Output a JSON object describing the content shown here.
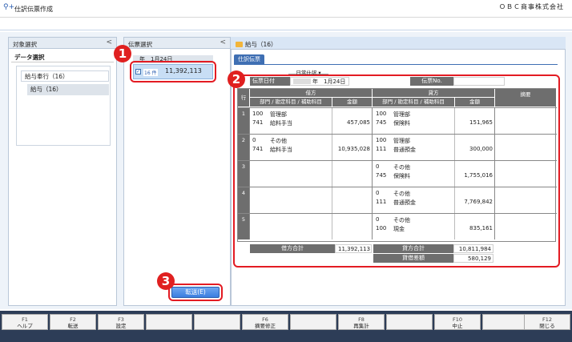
{
  "window": {
    "title": "仕訳伝票作成",
    "company": "ＯＢＣ商事株式会社"
  },
  "left": {
    "header": "対象選択",
    "data_label": "データ選択",
    "parent": "給与奉行（16）",
    "child": "給与（16）"
  },
  "middle": {
    "header": "伝票選択",
    "slip_header": "年　1月24日",
    "slip_count": "16 件",
    "slip_amount": "11,392,113",
    "transfer_button": "転送(E)"
  },
  "right": {
    "header": "給与（16）",
    "tab": "仕訳伝票",
    "type_select": "日常仕訳",
    "date_label": "伝票日付",
    "date_value": "年　1月24日",
    "no_label": "伝票No.",
    "col_row": "行",
    "col_debit": "借方",
    "col_credit": "貸方",
    "col_memo": "摘要",
    "col_dept": "部門 / 勘定科目 / 補助科目",
    "col_amount": "金額",
    "rows": [
      {
        "n": "1",
        "d_code1": "100",
        "d_name1": "管理部",
        "d_code2": "741",
        "d_name2": "給料手当",
        "d_amt": "457,085",
        "c_code1": "100",
        "c_name1": "管理部",
        "c_code2": "745",
        "c_name2": "保険料",
        "c_amt": "151,965"
      },
      {
        "n": "2",
        "d_code1": "0",
        "d_name1": "その他",
        "d_code2": "741",
        "d_name2": "給料手当",
        "d_amt": "10,935,028",
        "c_code1": "100",
        "c_name1": "管理部",
        "c_code2": "111",
        "c_name2": "普通預金",
        "c_amt": "300,000"
      },
      {
        "n": "3",
        "d_code1": "",
        "d_name1": "",
        "d_code2": "",
        "d_name2": "",
        "d_amt": "",
        "c_code1": "0",
        "c_name1": "その他",
        "c_code2": "745",
        "c_name2": "保険料",
        "c_amt": "1,755,016"
      },
      {
        "n": "4",
        "d_code1": "",
        "d_name1": "",
        "d_code2": "",
        "d_name2": "",
        "d_amt": "",
        "c_code1": "0",
        "c_name1": "その他",
        "c_code2": "111",
        "c_name2": "普通預金",
        "c_amt": "7,769,842"
      },
      {
        "n": "5",
        "d_code1": "",
        "d_name1": "",
        "d_code2": "",
        "d_name2": "",
        "d_amt": "",
        "c_code1": "0",
        "c_name1": "その他",
        "c_code2": "100",
        "c_name2": "現金",
        "c_amt": "835,161"
      }
    ],
    "debit_total_label": "借方合計",
    "debit_total": "11,392,113",
    "credit_total_label": "貸方合計",
    "credit_total": "10,811,984",
    "diff_label": "貸借差額",
    "diff": "580,129"
  },
  "markers": [
    "1",
    "2",
    "3"
  ],
  "fkeys": [
    {
      "key": "F1",
      "label": "ヘルプ"
    },
    {
      "key": "F2",
      "label": "転送"
    },
    {
      "key": "F3",
      "label": "設定"
    },
    {
      "key": "",
      "label": ""
    },
    {
      "key": "",
      "label": ""
    },
    {
      "key": "F6",
      "label": "摘要修正"
    },
    {
      "key": "",
      "label": ""
    },
    {
      "key": "F8",
      "label": "再集計"
    },
    {
      "key": "",
      "label": ""
    },
    {
      "key": "F10",
      "label": "中止"
    },
    {
      "key": "",
      "label": ""
    },
    {
      "key": "F12",
      "label": "閉じる"
    }
  ],
  "colors": {
    "accent": "#3f6fb3",
    "marker": "#e31b23"
  }
}
